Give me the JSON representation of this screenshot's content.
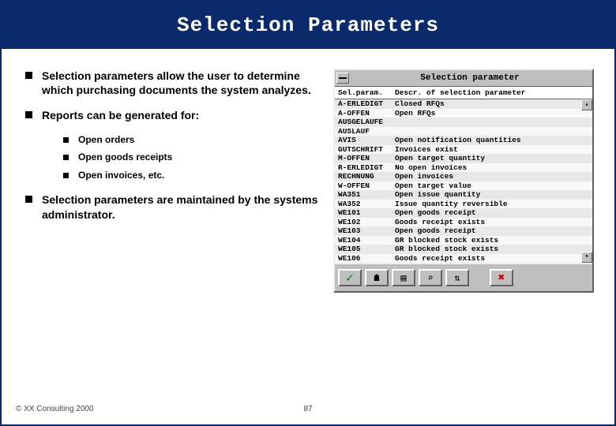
{
  "slide": {
    "title": "Selection Parameters",
    "footer_left": "© XX Consulting 2000",
    "page_number": "87"
  },
  "bullets": {
    "b1": "Selection parameters allow the user to determine which purchasing documents the system analyzes.",
    "b2": "Reports can be generated for:",
    "sub1": "Open orders",
    "sub2": "Open goods receipts",
    "sub3": "Open invoices, etc.",
    "b3": "Selection parameters are maintained by the systems administrator."
  },
  "sap": {
    "window_title": "Selection parameter",
    "header_param": "Sel.param.",
    "header_desc": "Descr. of selection parameter",
    "rows": [
      {
        "param": "A-ERLEDIGT",
        "desc": "Closed RFQs"
      },
      {
        "param": "A-OFFEN",
        "desc": "Open RFQs"
      },
      {
        "param": "AUSGELAUFE",
        "desc": ""
      },
      {
        "param": "AUSLAUF",
        "desc": ""
      },
      {
        "param": "AVIS",
        "desc": "Open notification quantities"
      },
      {
        "param": "GUTSCHRIFT",
        "desc": "Invoices exist"
      },
      {
        "param": "M-OFFEN",
        "desc": "Open target quantity"
      },
      {
        "param": "R-ERLEDIGT",
        "desc": "No open invoices"
      },
      {
        "param": "RECHNUNG",
        "desc": "Open invoices"
      },
      {
        "param": "W-OFFEN",
        "desc": "Open target value"
      },
      {
        "param": "WA351",
        "desc": "Open issue quantity"
      },
      {
        "param": "WA352",
        "desc": "Issue quantity reversible"
      },
      {
        "param": "WE101",
        "desc": "Open goods receipt"
      },
      {
        "param": "WE102",
        "desc": "Goods receipt exists"
      },
      {
        "param": "WE103",
        "desc": "Open goods receipt"
      },
      {
        "param": "WE104",
        "desc": "GR blocked stock exists"
      },
      {
        "param": "WE105",
        "desc": "GR blocked stock exists"
      },
      {
        "param": "WE106",
        "desc": "Goods receipt exists"
      }
    ],
    "buttons": {
      "confirm": "✓",
      "pick": "☗",
      "new": "▤",
      "find": "⌕",
      "sort": "⇅",
      "cancel": "✖"
    }
  }
}
